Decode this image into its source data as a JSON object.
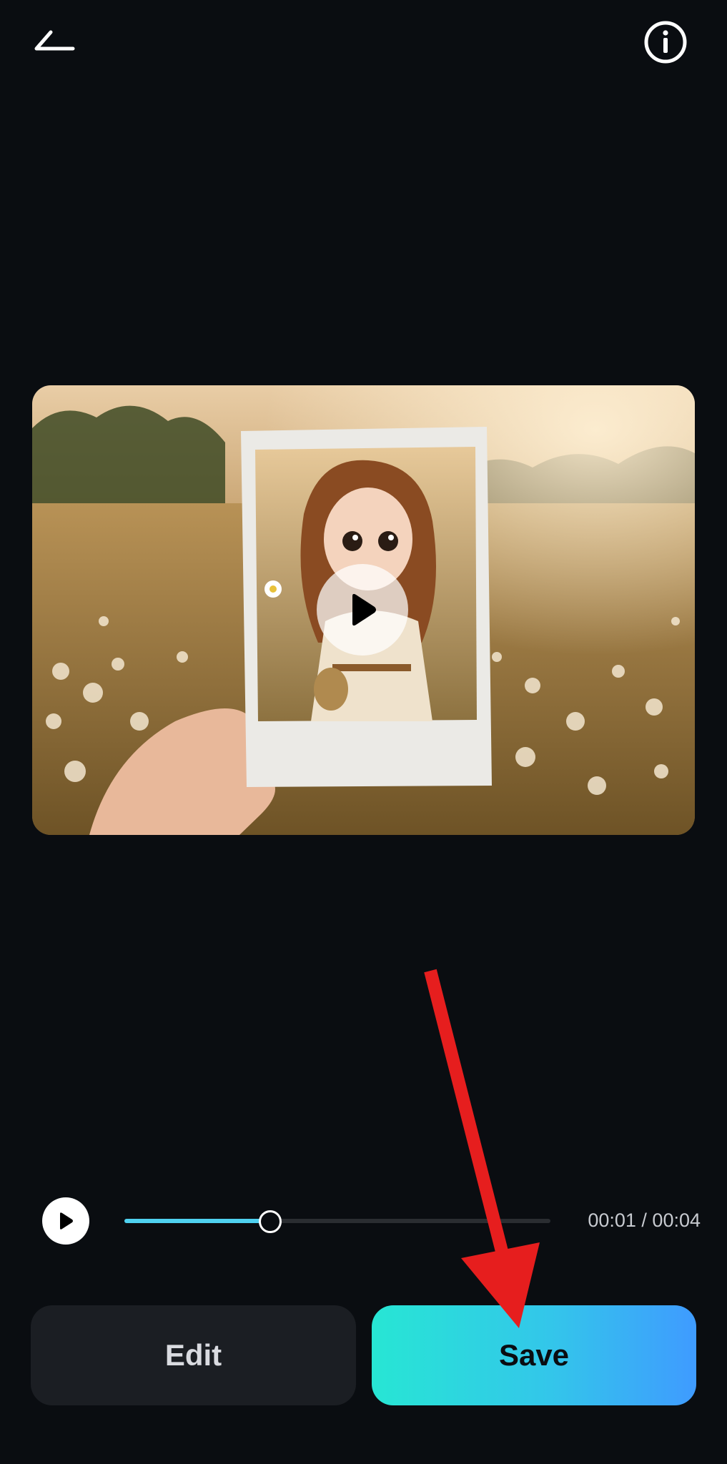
{
  "topbar": {
    "back_icon": "back-arrow-icon",
    "info_icon": "info-icon"
  },
  "preview": {
    "play_icon": "play-icon"
  },
  "playback": {
    "play_icon": "play-icon",
    "progress_fraction": 0.34,
    "current_time": "00:01",
    "separator": " / ",
    "total_time": "00:04",
    "time_display": "00:01 / 00:04",
    "track_color": "#2a2d31",
    "fill_color": "#4fd1f0"
  },
  "actions": {
    "edit_label": "Edit",
    "save_label": "Save"
  },
  "colors": {
    "background": "#0a0d11",
    "edit_button_bg": "#1b1e23",
    "save_gradient_start": "#27e6d4",
    "save_gradient_end": "#3f9bff",
    "annotation_arrow": "#e61e1e"
  }
}
